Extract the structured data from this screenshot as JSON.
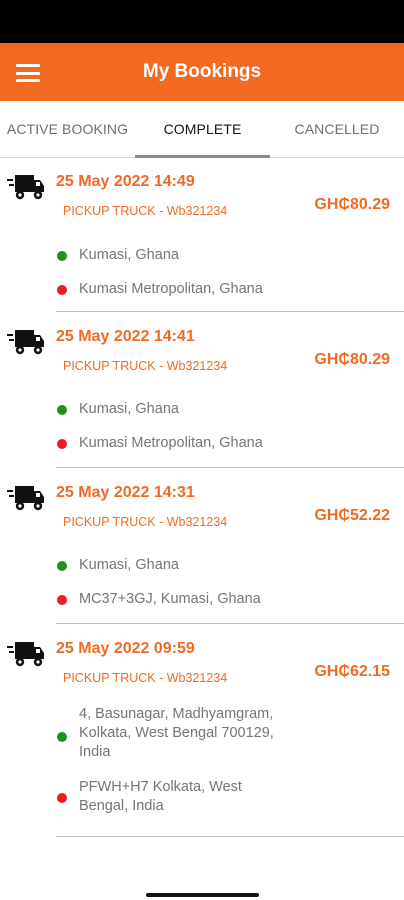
{
  "app": {
    "title": "My Bookings"
  },
  "tabs": [
    {
      "label": "ACTIVE BOOKING"
    },
    {
      "label": "COMPLETE"
    },
    {
      "label": "CANCELLED"
    }
  ],
  "bookings": [
    {
      "date": "25 May 2022 14:49",
      "vehicle": "PICKUP TRUCK - Wb321234",
      "price": "GH₵80.29",
      "pickup": "Kumasi, Ghana",
      "dropoff": "Kumasi Metropolitan, Ghana"
    },
    {
      "date": "25 May 2022 14:41",
      "vehicle": "PICKUP TRUCK - Wb321234",
      "price": "GH₵80.29",
      "pickup": "Kumasi, Ghana",
      "dropoff": "Kumasi Metropolitan, Ghana"
    },
    {
      "date": "25 May 2022 14:31",
      "vehicle": "PICKUP TRUCK - Wb321234",
      "price": "GH₵52.22",
      "pickup": "Kumasi, Ghana",
      "dropoff": "MC37+3GJ, Kumasi, Ghana"
    },
    {
      "date": "25 May 2022 09:59",
      "vehicle": "PICKUP TRUCK - Wb321234",
      "price": "GH₵62.15",
      "pickup": [
        "4, Basunagar, Madhyamgram,",
        "Kolkata, West Bengal 700129,",
        "India"
      ],
      "dropoff": [
        "PFWH+H7 Kolkata, West",
        "Bengal, India"
      ]
    }
  ],
  "colors": {
    "accent": "#f26a21",
    "pickup_dot": "#1f8f1f",
    "dropoff_dot": "#ee1c25"
  },
  "icons": {
    "menu": "hamburger-menu-icon",
    "truck": "delivery-truck-icon"
  }
}
